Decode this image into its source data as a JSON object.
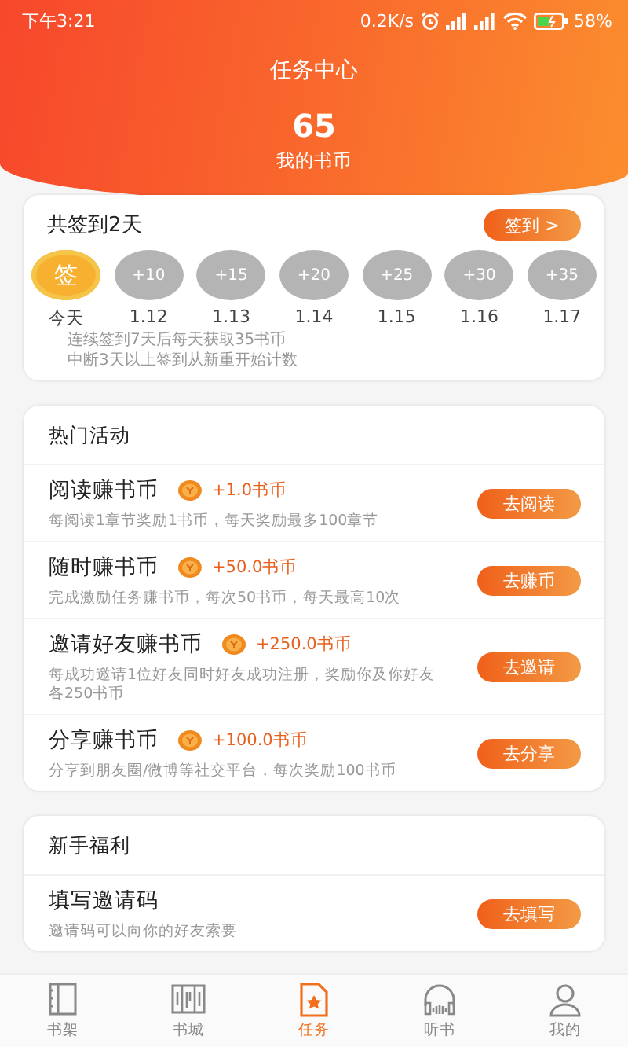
{
  "status_bar": {
    "time": "下午3:21",
    "speed": "0.2K/s",
    "battery": "58%"
  },
  "header": {
    "title": "任务中心",
    "coins": "65",
    "coins_label": "我的书币"
  },
  "sign_in": {
    "title": "共签到2天",
    "button": "签到 >",
    "days": [
      {
        "coin": "签",
        "date": "今天",
        "signed": true
      },
      {
        "coin": "+10",
        "date": "1.12",
        "signed": false
      },
      {
        "coin": "+15",
        "date": "1.13",
        "signed": false
      },
      {
        "coin": "+20",
        "date": "1.14",
        "signed": false
      },
      {
        "coin": "+25",
        "date": "1.15",
        "signed": false
      },
      {
        "coin": "+30",
        "date": "1.16",
        "signed": false
      },
      {
        "coin": "+35",
        "date": "1.17",
        "signed": false
      }
    ],
    "notes": [
      "连续签到7天后每天获取35书币",
      "中断3天以上签到从新重开始计数"
    ]
  },
  "sections": [
    {
      "title": "热门活动",
      "tasks": [
        {
          "title": "阅读赚书币",
          "reward": "+1.0书币",
          "description": "每阅读1章节奖励1书币，每天奖励最多100章节",
          "button": "去阅读"
        },
        {
          "title": "随时赚书币",
          "reward": "+50.0书币",
          "description": "完成激励任务赚书币，每次50书币，每天最高10次",
          "button": "去赚币"
        },
        {
          "title": "邀请好友赚书币",
          "reward": "+250.0书币",
          "description": "每成功邀请1位好友同时好友成功注册，奖励你及你好友各250书币",
          "button": "去邀请"
        },
        {
          "title": "分享赚书币",
          "reward": "+100.0书币",
          "description": "分享到朋友圈/微博等社交平台，每次奖励100书币",
          "button": "去分享"
        }
      ]
    },
    {
      "title": "新手福利",
      "tasks": [
        {
          "title": "填写邀请码",
          "description": "邀请码可以向你的好友索要",
          "button": "去填写"
        }
      ]
    }
  ],
  "tab_bar": [
    {
      "kind": "shelf",
      "label": "书架",
      "selected": false
    },
    {
      "kind": "store",
      "label": "书城",
      "selected": false
    },
    {
      "kind": "task",
      "label": "任务",
      "selected": true
    },
    {
      "kind": "listen",
      "label": "听书",
      "selected": false
    },
    {
      "kind": "profile",
      "label": "我的",
      "selected": false
    }
  ]
}
